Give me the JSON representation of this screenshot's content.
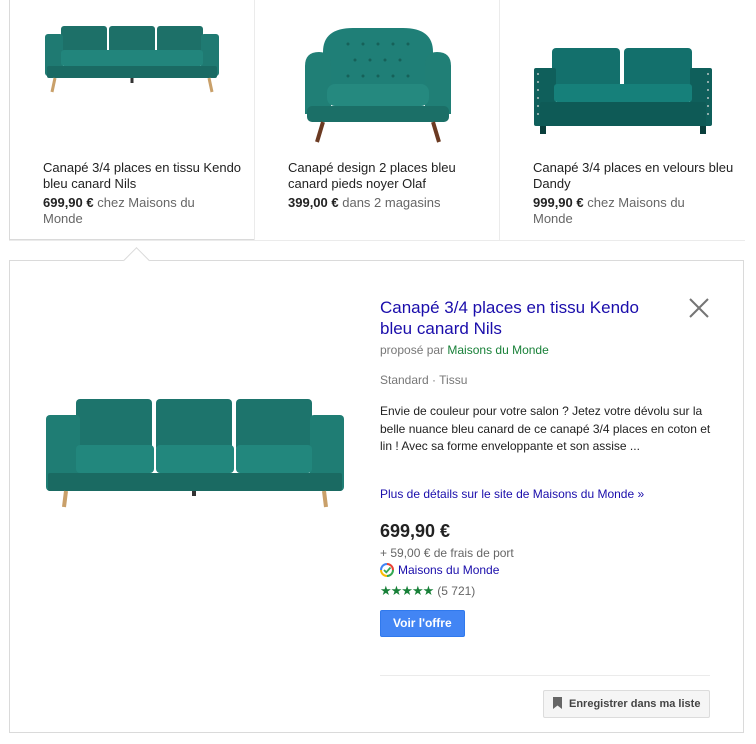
{
  "products": [
    {
      "title": "Canapé 3/4 places en tissu Kendo bleu canard Nils",
      "price": "699,90 €",
      "source": "chez Maisons du Monde",
      "image": "teal-sofa-3-seat-image",
      "selected": true
    },
    {
      "title": "Canapé design 2 places bleu canard pieds noyer Olaf",
      "price": "399,00 €",
      "source": "dans 2 magasins",
      "image": "teal-loveseat-image",
      "selected": false
    },
    {
      "title": "Canapé 3/4 places en velours bleu Dandy",
      "price": "999,90 €",
      "source": "chez Maisons du Monde",
      "image": "velvet-sofa-image",
      "selected": false
    }
  ],
  "detail": {
    "title": "Canapé 3/4 places en tissu Kendo bleu canard Nils",
    "offered_by_label": "proposé par",
    "offered_by_merchant": "Maisons du Monde",
    "tags": "Standard · Tissu",
    "description": "Envie de couleur pour votre salon ? Jetez votre dévolu sur la belle nuance bleu canard de ce canapé 3/4 places en coton et lin ! Avec sa forme enveloppante et son assise ...",
    "more_link": "Plus de détails sur le site de Maisons du Monde »",
    "price": "699,90 €",
    "shipping": "+ 59,00 € de frais de port",
    "merchant": "Maisons du Monde",
    "stars": "★★★★★",
    "rating_count": "(5 721)",
    "offer_button": "Voir l'offre",
    "save_button": "Enregistrer dans ma liste",
    "close_icon": "close-icon"
  },
  "colors": {
    "link": "#1a0dab",
    "green": "#188038",
    "button_blue": "#4285f4",
    "sofa_teal": "#1e7a72"
  }
}
